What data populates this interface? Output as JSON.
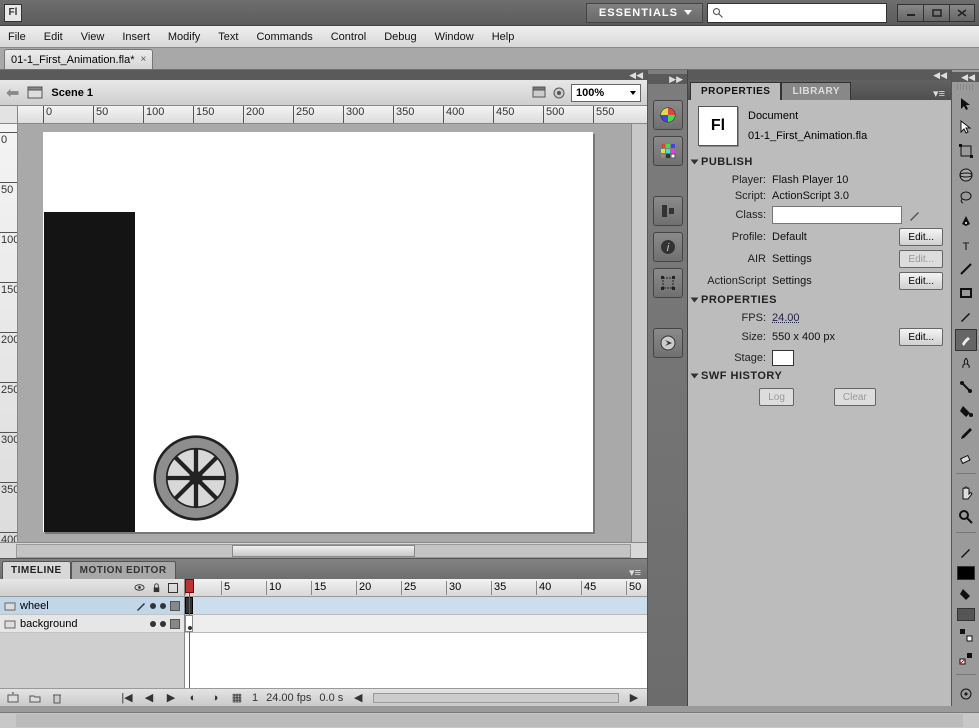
{
  "workspace": "ESSENTIALS",
  "menu": [
    "File",
    "Edit",
    "View",
    "Insert",
    "Modify",
    "Text",
    "Commands",
    "Control",
    "Debug",
    "Window",
    "Help"
  ],
  "doc_tab": "01-1_First_Animation.fla*",
  "scene": "Scene 1",
  "zoom": "100%",
  "ruler_h": [
    "0",
    "50",
    "100",
    "150",
    "200",
    "250",
    "300",
    "350",
    "400",
    "450",
    "500",
    "550"
  ],
  "ruler_v": [
    "0",
    "50",
    "100",
    "150",
    "200",
    "250",
    "300",
    "350",
    "400"
  ],
  "timeline": {
    "tabs": [
      "TIMELINE",
      "MOTION EDITOR"
    ],
    "frame_marks": [
      "1",
      "5",
      "10",
      "15",
      "20",
      "25",
      "30",
      "35",
      "40",
      "45",
      "50"
    ],
    "layers": [
      "wheel",
      "background"
    ],
    "status": {
      "frame": "1",
      "fps": "24.00 fps",
      "time": "0.0 s"
    }
  },
  "props": {
    "tabs": [
      "PROPERTIES",
      "LIBRARY"
    ],
    "doc_kind": "Document",
    "doc_name": "01-1_First_Animation.fla",
    "sections": {
      "publish": {
        "title": "PUBLISH",
        "player_label": "Player:",
        "player": "Flash Player 10",
        "script_label": "Script:",
        "script": "ActionScript 3.0",
        "class_label": "Class:",
        "profile_label": "Profile:",
        "profile": "Default",
        "air_label": "AIR",
        "air_value": "Settings",
        "as_label": "ActionScript",
        "as_value": "Settings",
        "edit": "Edit..."
      },
      "properties": {
        "title": "PROPERTIES",
        "fps_label": "FPS:",
        "fps": "24.00",
        "size_label": "Size:",
        "size": "550 x 400 px",
        "stage_label": "Stage:",
        "edit": "Edit..."
      },
      "history": {
        "title": "SWF HISTORY",
        "log": "Log",
        "clear": "Clear"
      }
    }
  }
}
